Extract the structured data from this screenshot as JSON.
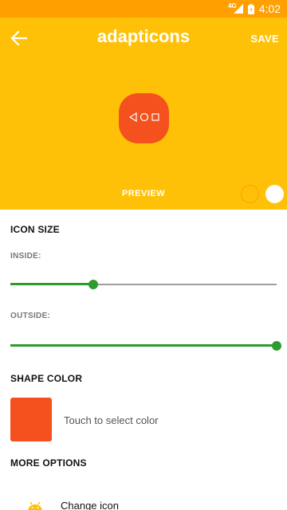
{
  "status_bar": {
    "network": "4G",
    "time": "4:02"
  },
  "header": {
    "title": "adapticons",
    "save_label": "SAVE",
    "preview_label": "PREVIEW"
  },
  "colors": {
    "status_bar": "#FFA000",
    "header": "#FFC107",
    "icon_shape": "#F4511E",
    "slider_accent": "#2E9B2E"
  },
  "icon_size": {
    "title": "ICON SIZE",
    "inside_label": "INSIDE:",
    "inside_value": 0.31,
    "outside_label": "OUTSIDE:",
    "outside_value": 1.0
  },
  "shape_color": {
    "title": "SHAPE COLOR",
    "hint": "Touch to select color",
    "value": "#F4511E"
  },
  "more_options": {
    "title": "MORE OPTIONS",
    "items": [
      {
        "label": "Change icon",
        "icon": "android-icon"
      }
    ]
  }
}
